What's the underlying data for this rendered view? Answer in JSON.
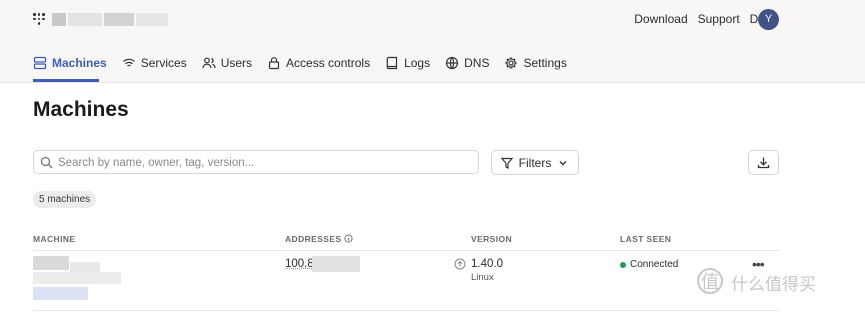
{
  "header": {
    "links": [
      "Download",
      "Support",
      "Docs"
    ],
    "avatar_initial": "Y"
  },
  "nav": {
    "tabs": [
      {
        "label": "Machines",
        "icon": "server-icon",
        "active": true
      },
      {
        "label": "Services",
        "icon": "wifi-icon"
      },
      {
        "label": "Users",
        "icon": "users-icon"
      },
      {
        "label": "Access controls",
        "icon": "lock-icon"
      },
      {
        "label": "Logs",
        "icon": "book-icon"
      },
      {
        "label": "DNS",
        "icon": "globe-icon"
      },
      {
        "label": "Settings",
        "icon": "gear-icon"
      }
    ]
  },
  "page": {
    "title": "Machines",
    "search_placeholder": "Search by name, owner, tag, version...",
    "filters_label": "Filters",
    "count_badge": "5 machines"
  },
  "table": {
    "headers": [
      "MACHINE",
      "ADDRESSES",
      "VERSION",
      "LAST SEEN"
    ],
    "rows": [
      {
        "address": "100.8",
        "version": "1.40.0",
        "os": "Linux",
        "status": "Connected"
      }
    ]
  },
  "watermark": {
    "glyph": "值",
    "text": "什么值得买"
  },
  "colors": {
    "accent": "#3f5db6",
    "connected": "#1f9d55",
    "avatar": "#3f5386"
  }
}
